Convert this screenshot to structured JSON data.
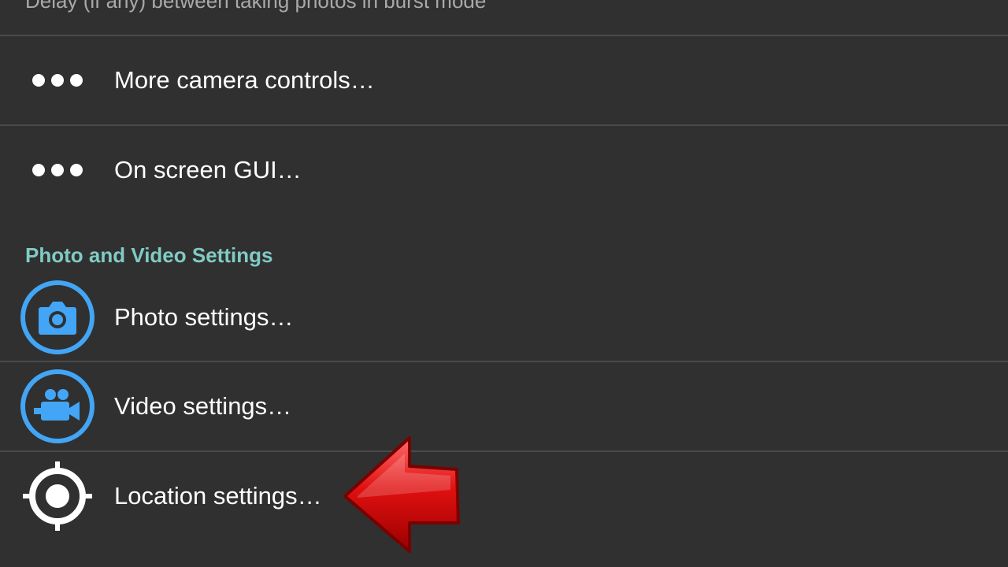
{
  "top_summary": "Delay (if any) between taking photos in burst mode",
  "rows": {
    "more_camera_controls": {
      "label": "More camera controls…",
      "icon": "more-dots-icon"
    },
    "on_screen_gui": {
      "label": "On screen GUI…",
      "icon": "more-dots-icon"
    },
    "photo_settings": {
      "label": "Photo settings…",
      "icon": "camera-icon"
    },
    "video_settings": {
      "label": "Video settings…",
      "icon": "video-camera-icon"
    },
    "location_settings": {
      "label": "Location settings…",
      "icon": "location-target-icon"
    }
  },
  "category": {
    "title": "Photo and Video Settings"
  },
  "colors": {
    "background": "#303030",
    "divider": "#4a4a4a",
    "category_accent": "#80cbc4",
    "icon_blue": "#42a5f5",
    "arrow_red": "#d50000"
  }
}
